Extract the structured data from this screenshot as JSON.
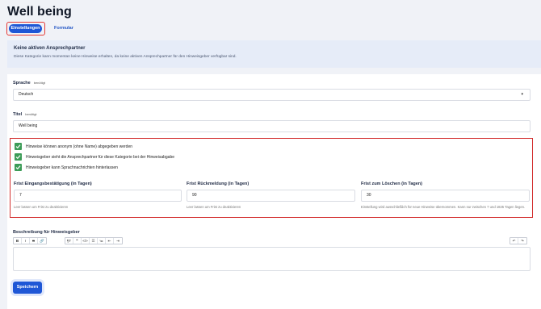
{
  "page": {
    "title": "Well being"
  },
  "tabs": {
    "active": "Einstellungen",
    "other": "Formular"
  },
  "notice": {
    "title": "Keine aktiven Ansprechpartner",
    "text": "Diese Kategorie kann momentan keine Hinweise erhalten, da keine aktiven Ansprechpartner für den Hinweisgeber verfügbar sind."
  },
  "form": {
    "language": {
      "label": "Sprache",
      "required": "benötigt",
      "value": "Deutsch"
    },
    "title": {
      "label": "Titel",
      "required": "benötigt",
      "value": "Well being"
    },
    "checkboxes": [
      {
        "label": "Hinweise können anonym (ohne Name) abgegeben werden",
        "checked": true
      },
      {
        "label": "Hinweisgeber sieht die Ansprechpartner für diese Kategorie bei der Hinweisabgabe",
        "checked": true
      },
      {
        "label": "Hinweisgeber kann Sprachnachrichten hinterlassen",
        "checked": true
      }
    ],
    "deadlines": [
      {
        "label": "Frist Eingangsbestätigung (in Tagen)",
        "value": "7",
        "help": "Leer lassen um Frist zu deaktivieren"
      },
      {
        "label": "Frist Rückmeldung (in Tagen)",
        "value": "90",
        "help": "Leer lassen um Frist zu deaktivieren"
      },
      {
        "label": "Frist zum Löschen (in Tagen)",
        "value": "30",
        "help": "Einstellung wird ausschließlich für neue Hinweise übernommen. Kann nur zwischen 7 und 1825 Tagen liegen."
      }
    ],
    "description": {
      "label": "Beschreibung für Hinweisgeber"
    },
    "toolbar": {
      "format": [
        "B",
        "I",
        "S",
        "🔗"
      ],
      "blocks": [
        "¶T",
        "❞",
        "</>",
        "☰",
        "≔",
        "⇤",
        "⇥"
      ],
      "history": [
        "↶",
        "↷"
      ]
    },
    "save_label": "Speichern"
  },
  "colors": {
    "primary": "#1f57d6",
    "checkbox": "#3d9c58",
    "highlight": "#d32f2f",
    "notice_bg": "#e6ecf8"
  }
}
